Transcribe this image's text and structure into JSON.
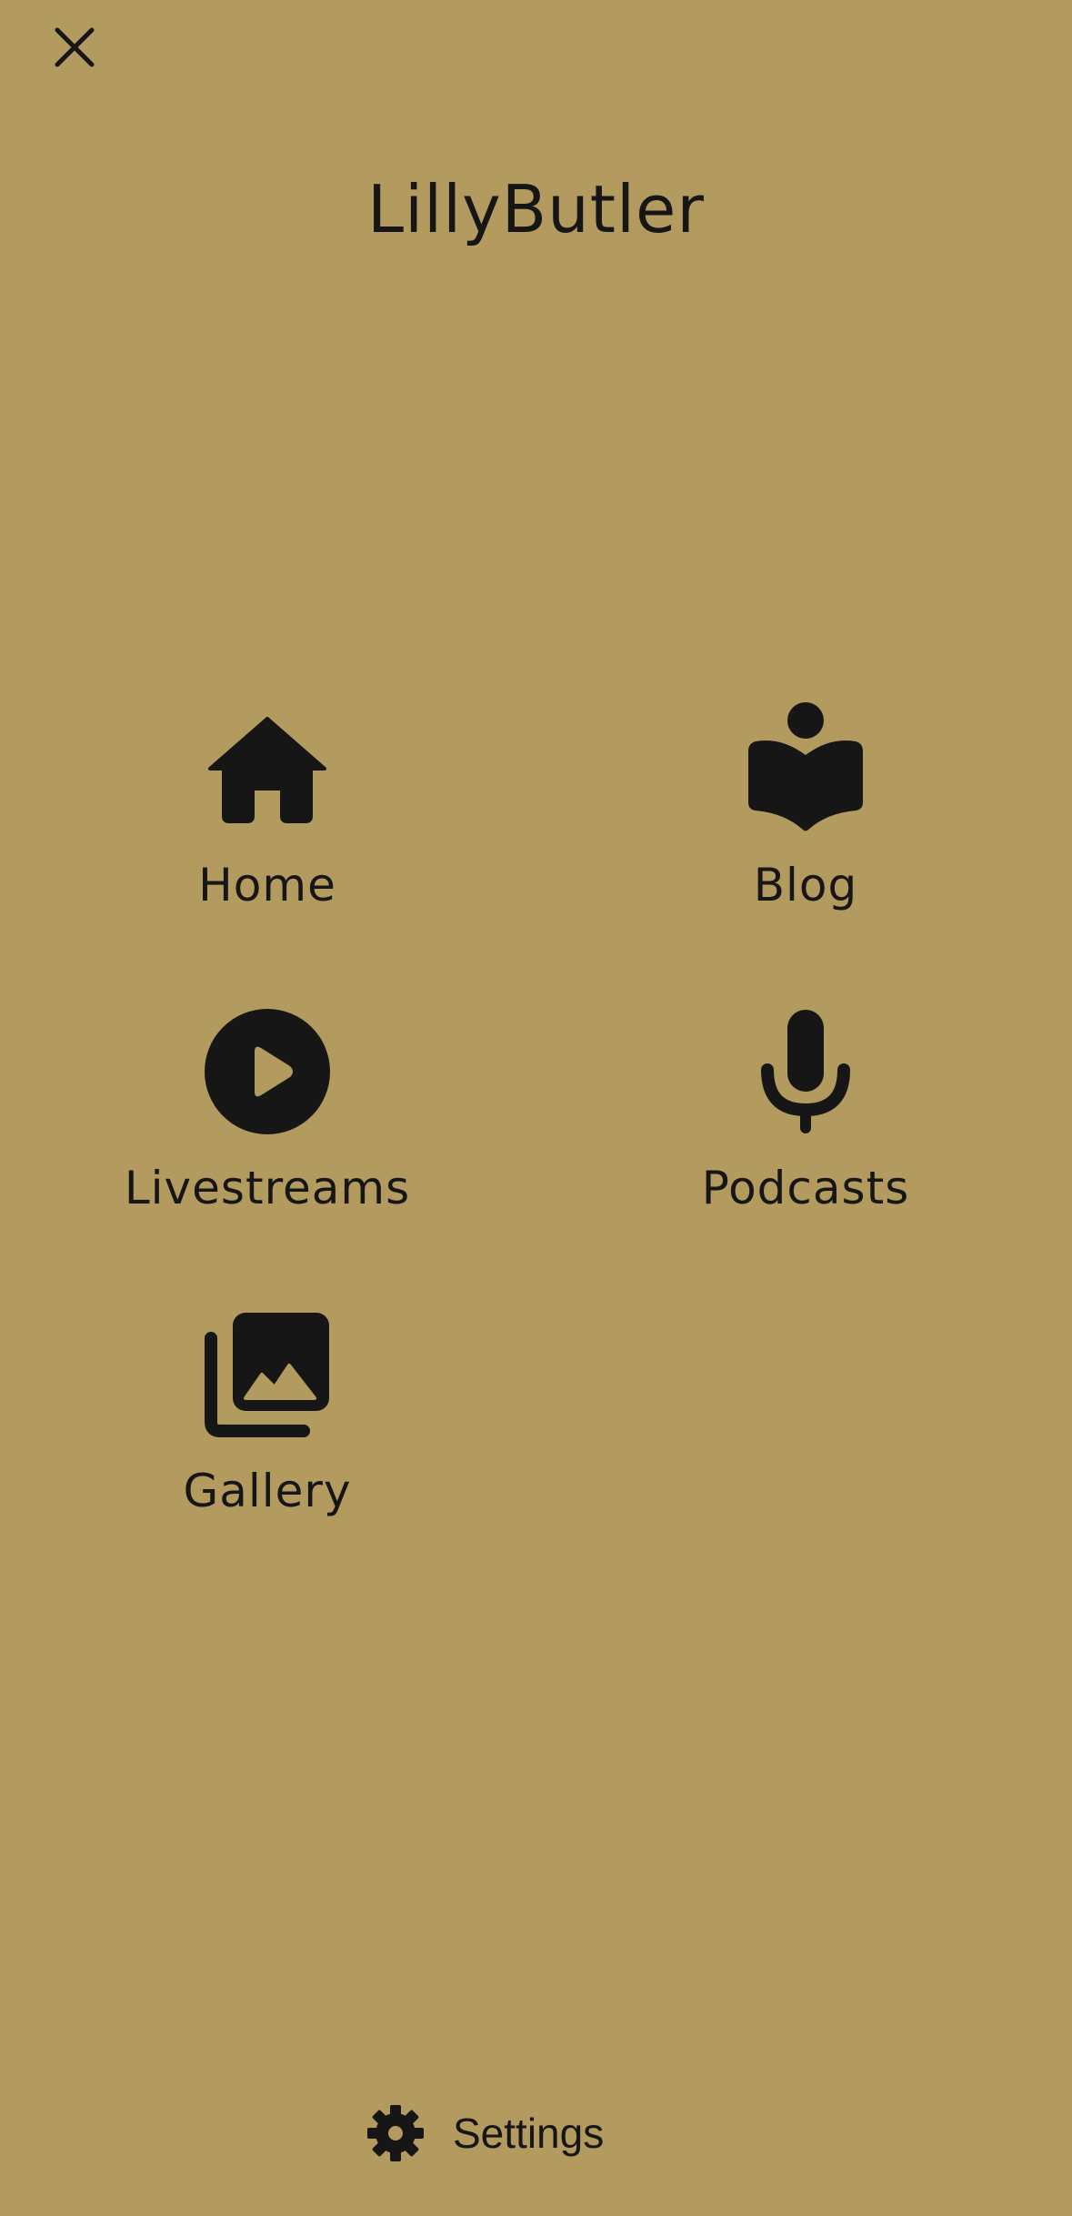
{
  "header": {
    "close_icon": "close-icon",
    "title": "LillyButler"
  },
  "menu": {
    "items": [
      {
        "label": "Home",
        "icon": "home-icon"
      },
      {
        "label": "Blog",
        "icon": "book-reader-icon"
      },
      {
        "label": "Livestreams",
        "icon": "play-circle-icon"
      },
      {
        "label": "Podcasts",
        "icon": "microphone-icon"
      },
      {
        "label": "Gallery",
        "icon": "photo-library-icon"
      }
    ]
  },
  "footer": {
    "settings_label": "Settings",
    "settings_icon": "gear-icon"
  },
  "colors": {
    "background": "#B39A5E",
    "foreground": "#161616"
  }
}
